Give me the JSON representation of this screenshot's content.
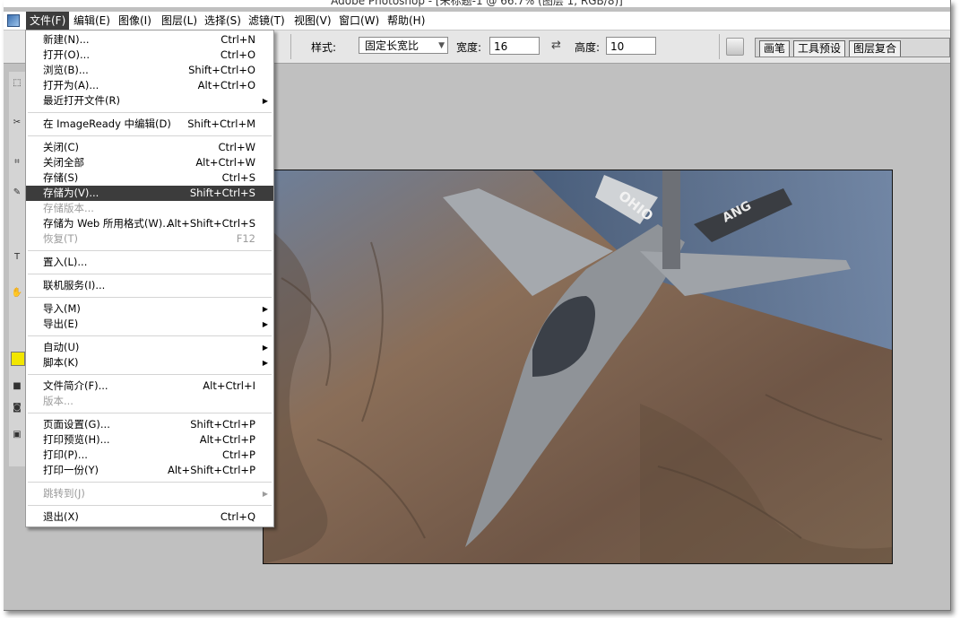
{
  "window": {
    "title": "Adobe Photoshop - [未标题-1 @ 66.7% (图层 1, RGB/8)]"
  },
  "menubar": [
    {
      "label": "文件(F)",
      "active": true
    },
    {
      "label": "编辑(E)"
    },
    {
      "label": "图像(I)"
    },
    {
      "label": "图层(L)"
    },
    {
      "label": "选择(S)"
    },
    {
      "label": "滤镜(T)"
    },
    {
      "label": "视图(V)"
    },
    {
      "label": "窗口(W)"
    },
    {
      "label": "帮助(H)"
    }
  ],
  "options": {
    "style_label": "样式:",
    "style_value": "固定长宽比",
    "width_label": "宽度:",
    "width_value": "16",
    "height_label": "高度:",
    "height_value": "10",
    "palette_tabs": [
      "画笔",
      "工具预设",
      "图层复合"
    ]
  },
  "file_menu": [
    {
      "label": "新建(N)...",
      "shortcut": "Ctrl+N"
    },
    {
      "label": "打开(O)...",
      "shortcut": "Ctrl+O"
    },
    {
      "label": "浏览(B)...",
      "shortcut": "Shift+Ctrl+O"
    },
    {
      "label": "打开为(A)...",
      "shortcut": "Alt+Ctrl+O"
    },
    {
      "label": "最近打开文件(R)",
      "submenu": true
    },
    {
      "sep": true
    },
    {
      "label": "在 ImageReady 中编辑(D)",
      "shortcut": "Shift+Ctrl+M"
    },
    {
      "sep": true
    },
    {
      "label": "关闭(C)",
      "shortcut": "Ctrl+W"
    },
    {
      "label": "关闭全部",
      "shortcut": "Alt+Ctrl+W"
    },
    {
      "label": "存储(S)",
      "shortcut": "Ctrl+S"
    },
    {
      "label": "存储为(V)...",
      "shortcut": "Shift+Ctrl+S",
      "highlighted": true
    },
    {
      "label": "存储版本...",
      "disabled": true
    },
    {
      "label": "存储为 Web 所用格式(W)...",
      "shortcut": "Alt+Shift+Ctrl+S"
    },
    {
      "label": "恢复(T)",
      "shortcut": "F12",
      "disabled": true
    },
    {
      "sep": true
    },
    {
      "label": "置入(L)..."
    },
    {
      "sep": true
    },
    {
      "label": "联机服务(I)..."
    },
    {
      "sep": true
    },
    {
      "label": "导入(M)",
      "submenu": true
    },
    {
      "label": "导出(E)",
      "submenu": true
    },
    {
      "sep": true
    },
    {
      "label": "自动(U)",
      "submenu": true
    },
    {
      "label": "脚本(K)",
      "submenu": true
    },
    {
      "sep": true
    },
    {
      "label": "文件简介(F)...",
      "shortcut": "Alt+Ctrl+I"
    },
    {
      "label": "版本...",
      "disabled": true
    },
    {
      "sep": true
    },
    {
      "label": "页面设置(G)...",
      "shortcut": "Shift+Ctrl+P"
    },
    {
      "label": "打印预览(H)...",
      "shortcut": "Alt+Ctrl+P"
    },
    {
      "label": "打印(P)...",
      "shortcut": "Ctrl+P"
    },
    {
      "label": "打印一份(Y)",
      "shortcut": "Alt+Shift+Ctrl+P"
    },
    {
      "sep": true
    },
    {
      "label": "跳转到(J)",
      "submenu": true,
      "disabled": true
    },
    {
      "sep": true
    },
    {
      "label": "退出(X)",
      "shortcut": "Ctrl+Q"
    }
  ],
  "canvas_image": {
    "subject": "F-15 fighter jet over desert mountains",
    "tail_text": "OHIO",
    "wing_text": "ANG"
  }
}
